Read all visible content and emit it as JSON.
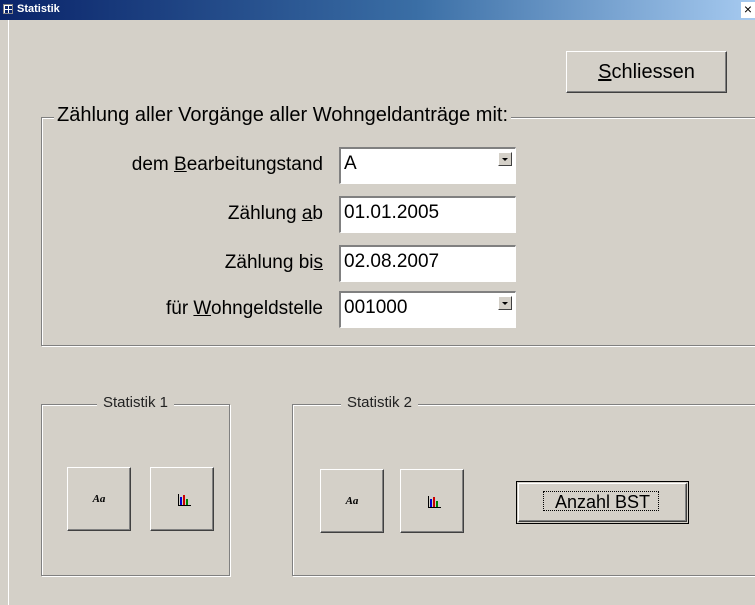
{
  "window": {
    "title": "Statistik",
    "close_label": "×"
  },
  "buttons": {
    "schliessen_prefix": "S",
    "schliessen_rest": "chliessen",
    "anzahl_bst": "Anzahl BST"
  },
  "main_group": {
    "legend": "Zählung aller Vorgänge aller Wohngeldanträge mit:",
    "bearbeitungstand": {
      "label_prefix": "dem ",
      "label_hotkey": "B",
      "label_rest": "earbeitungstand",
      "value": "A"
    },
    "zaehlung_ab": {
      "label_prefix": "Zählung ",
      "label_hotkey": "a",
      "label_rest": "b",
      "value": "01.01.2005"
    },
    "zaehlung_bis": {
      "label_prefix": "Zählung bi",
      "label_hotkey": "s",
      "label_rest": "",
      "value": "02.08.2007"
    },
    "wohngeldstelle": {
      "label_prefix": "für ",
      "label_hotkey": "W",
      "label_rest": "ohngeldstelle",
      "value": "001000"
    }
  },
  "statistik1": {
    "legend": "Statistik 1",
    "report_icon_text": "Aa"
  },
  "statistik2": {
    "legend": "Statistik 2",
    "report_icon_text": "Aa"
  },
  "colors": {
    "titlebar_start": "#0a246a",
    "titlebar_end": "#a6caf0",
    "face": "#d4d0c8",
    "bar_red": "#cc0000",
    "bar_blue": "#0000cc",
    "bar_green": "#008000"
  }
}
